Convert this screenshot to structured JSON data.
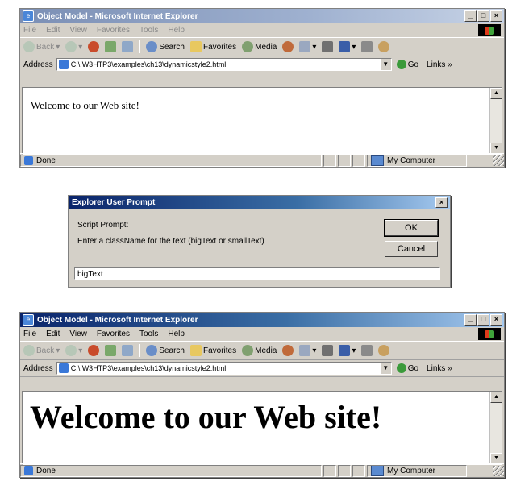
{
  "window1": {
    "title": "Object Model - Microsoft Internet Explorer",
    "menu": [
      "File",
      "Edit",
      "View",
      "Favorites",
      "Tools",
      "Help"
    ],
    "toolbar": {
      "back": "Back",
      "search": "Search",
      "favorites": "Favorites",
      "media": "Media"
    },
    "address_label": "Address",
    "address_value": "C:\\IW3HTP3\\examples\\ch13\\dynamicstyle2.html",
    "go": "Go",
    "links": "Links »",
    "page_text": "Welcome to our Web site!",
    "status": "Done",
    "zone": "My Computer"
  },
  "dialog": {
    "title": "Explorer User Prompt",
    "label1": "Script Prompt:",
    "label2": "Enter a className for the text (bigText or smallText)",
    "ok": "OK",
    "cancel": "Cancel",
    "input_value": "bigText"
  },
  "window2": {
    "title": "Object Model - Microsoft Internet Explorer",
    "menu": [
      "File",
      "Edit",
      "View",
      "Favorites",
      "Tools",
      "Help"
    ],
    "toolbar": {
      "back": "Back",
      "search": "Search",
      "favorites": "Favorites",
      "media": "Media"
    },
    "address_label": "Address",
    "address_value": "C:\\IW3HTP3\\examples\\ch13\\dynamicstyle2.html",
    "go": "Go",
    "links": "Links »",
    "page_text": "Welcome to our Web site!",
    "status": "Done",
    "zone": "My Computer"
  }
}
